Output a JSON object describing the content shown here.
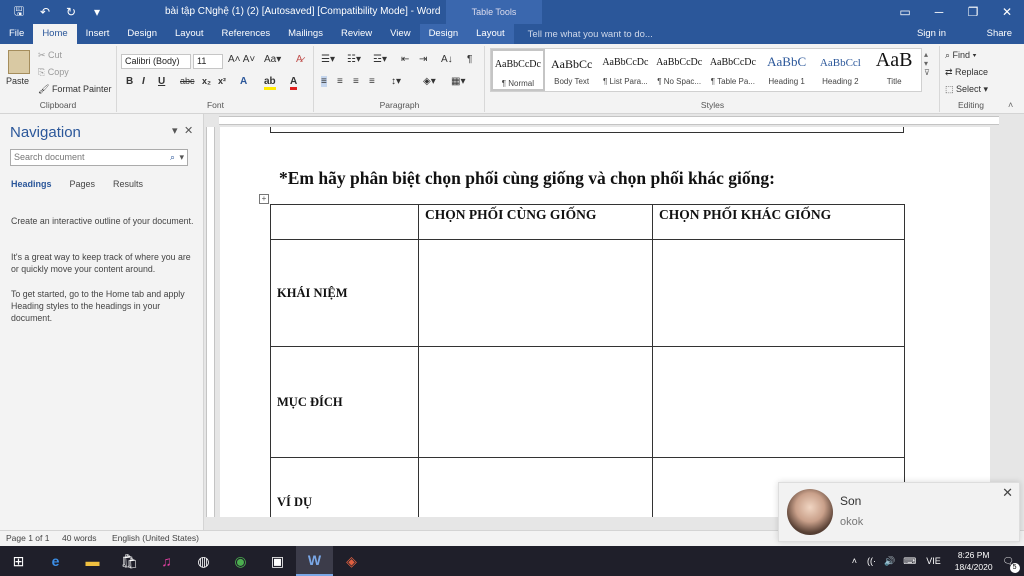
{
  "title_bar": {
    "doc_title": "bài tập CNghệ (1) (2) [Autosaved] [Compatibility Mode] - Word",
    "table_tools": "Table Tools",
    "qat": {
      "save_icon": "save-icon",
      "undo_icon": "undo-icon",
      "redo_icon": "redo-icon"
    }
  },
  "tabs": [
    "File",
    "Home",
    "Insert",
    "Design",
    "Layout",
    "References",
    "Mailings",
    "Review",
    "View",
    "Design",
    "Layout"
  ],
  "active_tab": "Home",
  "tell_me": "Tell me what you want to do...",
  "sign_in": "Sign in",
  "share": "Share",
  "ribbon": {
    "clipboard": {
      "paste": "Paste",
      "cut": "Cut",
      "copy": "Copy",
      "format_painter": "Format Painter",
      "label": "Clipboard"
    },
    "font": {
      "family": "Calibri (Body)",
      "size": "11",
      "label": "Font"
    },
    "paragraph": {
      "label": "Paragraph"
    },
    "styles": {
      "items": [
        {
          "preview": "AaBbCcDc",
          "name": "¶ Normal"
        },
        {
          "preview": "AaBbCc",
          "name": "Body Text"
        },
        {
          "preview": "AaBbCcDc",
          "name": "¶ List Para..."
        },
        {
          "preview": "AaBbCcDc",
          "name": "¶ No Spac..."
        },
        {
          "preview": "AaBbCcDc",
          "name": "¶ Table Pa..."
        },
        {
          "preview": "AaBbC",
          "name": "Heading 1"
        },
        {
          "preview": "AaBbCcl",
          "name": "Heading 2"
        },
        {
          "preview": "AaB",
          "name": "Title"
        }
      ],
      "label": "Styles"
    },
    "editing": {
      "find": "Find",
      "replace": "Replace",
      "select": "Select",
      "label": "Editing"
    }
  },
  "navigation": {
    "title": "Navigation",
    "search_placeholder": "Search document",
    "tabs": [
      "Headings",
      "Pages",
      "Results"
    ],
    "text1": "Create an interactive outline of your document.",
    "text2": "It's a great way to keep track of where you are or quickly move your content around.",
    "text3": "To get started, go to the Home tab and apply Heading styles to the headings in your document."
  },
  "document": {
    "heading": "*Em hãy phân biệt chọn phối cùng giống và chọn phối khác giống:",
    "table": {
      "headers": [
        "",
        "CHỌN PHỐI CÙNG GIỐNG",
        "CHỌN PHỐI KHÁC GIỐNG"
      ],
      "rows": [
        "KHÁI NIỆM",
        "MỤC ĐÍCH",
        "VÍ DỤ"
      ]
    }
  },
  "status": {
    "page": "Page 1 of 1",
    "words": "40 words",
    "language": "English (United States)"
  },
  "notification": {
    "name": "Son",
    "message": "okok"
  },
  "taskbar": {
    "lang": "VIE",
    "time": "8:26 PM",
    "date": "18/4/2020",
    "notif_count": "5"
  },
  "colors": {
    "word_blue": "#2b579a"
  }
}
